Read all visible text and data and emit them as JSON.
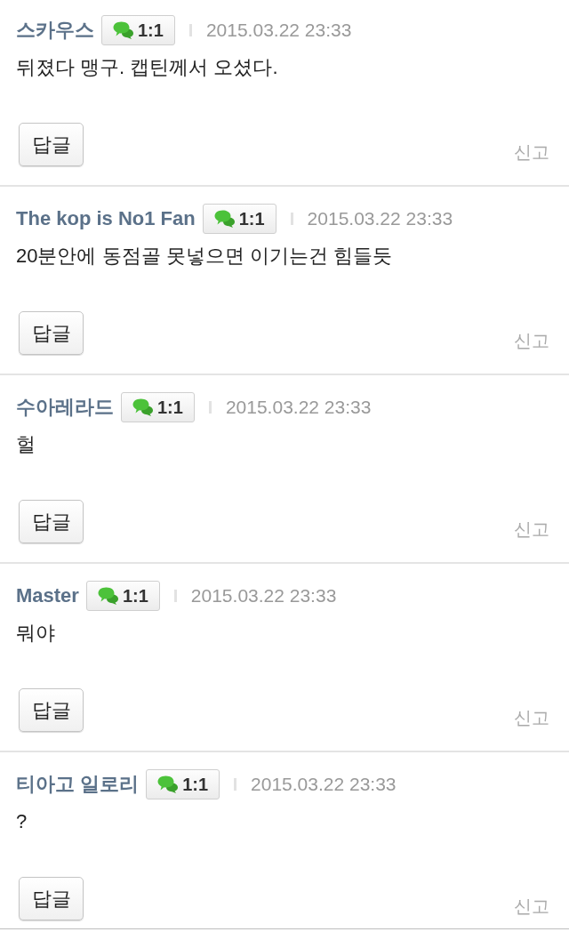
{
  "comments": [
    {
      "author": "스카우스",
      "badge": "1:1",
      "date": "2015.03.22 23:33",
      "text": "뒤졌다 맹구. 캡틴께서 오셨다.",
      "reply": "답글",
      "report": "신고"
    },
    {
      "author": "The kop is No1 Fan",
      "badge": "1:1",
      "date": "2015.03.22 23:33",
      "text": "20분안에 동점골 못넣으면 이기는건 힘들듯",
      "reply": "답글",
      "report": "신고"
    },
    {
      "author": "수아레라드",
      "badge": "1:1",
      "date": "2015.03.22 23:33",
      "text": "헐",
      "reply": "답글",
      "report": "신고"
    },
    {
      "author": "Master",
      "badge": "1:1",
      "date": "2015.03.22 23:33",
      "text": "뭐야",
      "reply": "답글",
      "report": "신고"
    },
    {
      "author": "티아고 일로리",
      "badge": "1:1",
      "date": "2015.03.22 23:33",
      "text": "?",
      "reply": "답글",
      "report": "신고"
    }
  ]
}
